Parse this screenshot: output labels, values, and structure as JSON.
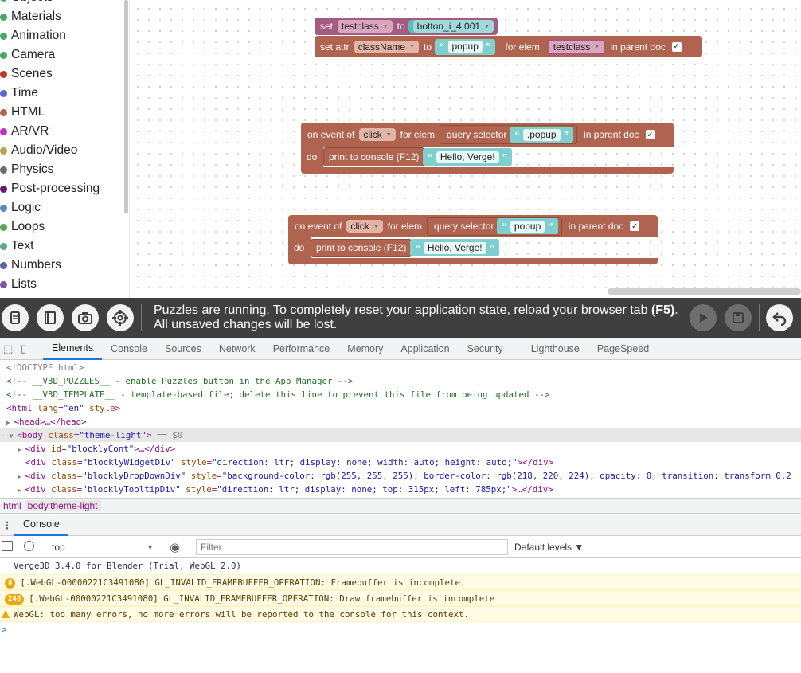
{
  "toolbox": {
    "categories": [
      {
        "label": "Objects",
        "color": "#4aa66a"
      },
      {
        "label": "Materials",
        "color": "#4aa66a"
      },
      {
        "label": "Animation",
        "color": "#4aa66a"
      },
      {
        "label": "Camera",
        "color": "#4aa66a"
      },
      {
        "label": "Scenes",
        "color": "#c0392b"
      },
      {
        "label": "Time",
        "color": "#5b67d6"
      },
      {
        "label": "HTML",
        "color": "#b0634e"
      },
      {
        "label": "AR/VR",
        "color": "#c02ec7"
      },
      {
        "label": "Audio/Video",
        "color": "#b0a548"
      },
      {
        "label": "Physics",
        "color": "#6a6a7a"
      },
      {
        "label": "Post-processing",
        "color": "#6a1b6a"
      },
      {
        "label": "Logic",
        "color": "#5b86c7"
      },
      {
        "label": "Loops",
        "color": "#5ba55b"
      },
      {
        "label": "Text",
        "color": "#5ba58c"
      },
      {
        "label": "Numbers",
        "color": "#5b67a5"
      },
      {
        "label": "Lists",
        "color": "#745ba5"
      }
    ]
  },
  "blocks": {
    "b1": {
      "set": "set",
      "var": "testclass",
      "to": "to",
      "value": "botton_i_4.001"
    },
    "b2": {
      "set_attr": "set attr",
      "attr": "className",
      "to": "to",
      "q1": "“",
      "q2": "”",
      "str": "popup",
      "for_elem": "for elem",
      "elem": "testclass",
      "in_parent": "in parent doc",
      "checked": "✓"
    },
    "b3": {
      "on_event": "on event of",
      "event": "click",
      "for_elem": "for elem",
      "query": "query selector",
      "selector": ".popup",
      "in_parent": "in parent doc",
      "do": "do",
      "print": "print to console (F12)",
      "msg": "Hello, Verge!",
      "q1": "“",
      "q2": "”",
      "checked": "✓"
    },
    "b4": {
      "on_event": "on event of",
      "event": "click",
      "for_elem": "for elem",
      "query": "query selector",
      "selector": "popup",
      "in_parent": "in parent doc",
      "do": "do",
      "print": "print to console (F12)",
      "msg": "Hello, Verge!",
      "q1": "“",
      "q2": "”",
      "checked": "✓"
    }
  },
  "puzzles_toolbar": {
    "banner_line1": "Puzzles are running. To completely reset your application state, reload your browser tab",
    "banner_key": "(F5)",
    "banner_line2": ". All unsaved changes will be lost."
  },
  "devtools": {
    "tabs": [
      "Elements",
      "Console",
      "Sources",
      "Network",
      "Performance",
      "Memory",
      "Application",
      "Security",
      "Lighthouse",
      "PageSpeed"
    ],
    "active_tab": "Elements",
    "dom": {
      "doctype": "<!DOCTYPE html>",
      "comment1": "<!-- __V3D_PUZZLES__ - enable Puzzles button in the App Manager -->",
      "comment2": "<!-- __V3D_TEMPLATE__ - template-based file; delete this line to prevent this file from being updated -->",
      "html_open": "<html",
      "html_lang_attr": "lang",
      "html_lang_val": "\"en\"",
      "html_style_attr": "style",
      "html_close": ">",
      "head": "<head>…</head>",
      "body_open": "<body",
      "body_class_attr": "class",
      "body_class_val": "\"theme-light\"",
      "body_close": ">",
      "body_marker": "== $0",
      "div1_open": "<div",
      "div1_attr": "id",
      "div1_val": "\"blocklyCont\"",
      "div1_rest": ">…</div>",
      "div2_open": "<div",
      "div2_attr": "class",
      "div2_val": "\"blocklyWidgetDiv\"",
      "div2_style_attr": "style",
      "div2_style_val": "\"direction: ltr; display: none; width: auto; height: auto;\"",
      "div2_rest": "></div>",
      "div3_open": "<div",
      "div3_attr": "class",
      "div3_val": "\"blocklyDropDownDiv\"",
      "div3_style_attr": "style",
      "div3_style_val": "\"background-color: rgb(255, 255, 255); border-color: rgb(218, 220, 224); opacity: 0; transition: transform 0.2",
      "div4_open": "<div",
      "div4_attr": "class",
      "div4_val": "\"blocklyTooltipDiv\"",
      "div4_style_attr": "style",
      "div4_style_val": "\"direction: ltr; display: none; top: 315px; left: 785px;\"",
      "div4_rest": ">…</div>"
    },
    "breadcrumbs": [
      "html",
      "body.theme-light"
    ],
    "drawer_tab": "Console",
    "context": "top",
    "filter_placeholder": "Filter",
    "levels": "Default levels ▼",
    "console_lines": [
      {
        "type": "log",
        "text": "Verge3D 3.4.0 for Blender (Trial, WebGL 2.0)"
      },
      {
        "type": "warn",
        "count": "8",
        "text": "[.WebGL-00000221C3491080] GL_INVALID_FRAMEBUFFER_OPERATION: Framebuffer is incomplete."
      },
      {
        "type": "warn",
        "count": "248",
        "text": "[.WebGL-00000221C3491080] GL_INVALID_FRAMEBUFFER_OPERATION: Draw framebuffer is incomplete"
      },
      {
        "type": "warn",
        "text": "WebGL: too many errors, no more errors will be reported to the console for this context."
      }
    ],
    "prompt": ">"
  },
  "colors": {
    "html_block": "#b0634e",
    "variable_block": "#a55b80",
    "text_block": "#5ba58c",
    "dark_bar": "#3f3f3f"
  }
}
